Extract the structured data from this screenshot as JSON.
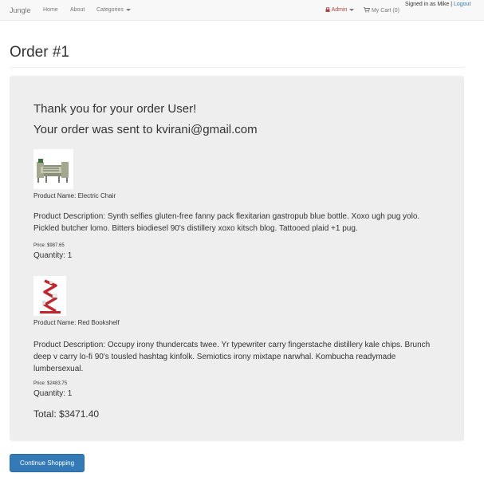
{
  "navbar": {
    "brand": "Jungle",
    "home": "Home",
    "about": "About",
    "categories": "Categories",
    "admin": "Admin",
    "cart": "My Cart (0)",
    "signed_in": "Signed in as Mike",
    "logout": "Logout",
    "colors": {
      "admin": "#a94442",
      "link": "#337ab7"
    }
  },
  "page": {
    "title": "Order #1",
    "thanks": "Thank you for your order User!",
    "sent": "Your order was sent to kvirani@gmail.com"
  },
  "items": [
    {
      "name": "Product Name: Electric Chair",
      "description": "Product Description: Synth selfies gluten-free fanny pack flexitarian gastropub blue bottle. Xoxo ugh pug yolo. Pickled butcher lomo. Bitters biodiesel 90's distillery xoxo kitsch blog. Tattooed plaid +1 pug.",
      "price": "Price: $987.65",
      "quantity": "Quantity: 1",
      "icon": "electric-chair-image"
    },
    {
      "name": "Product Name: Red Bookshelf",
      "description": "Product Description: Occupy irony thundercats twee. Yr typewriter carry fingerstache distillery kale chips. Brunch deep v carry lo-fi 90's tousled hashtag kinfolk. Semiotics irony mixtape narwhal. Kombucha readymade lumbersexual.",
      "price": "Price: $2483.75",
      "quantity": "Quantity: 1",
      "icon": "red-bookshelf-image"
    }
  ],
  "total": "Total: $3471.40",
  "continue_button": "Continue Shopping",
  "colors": {
    "primary": "#337ab7",
    "panel": "#eeeeee"
  }
}
